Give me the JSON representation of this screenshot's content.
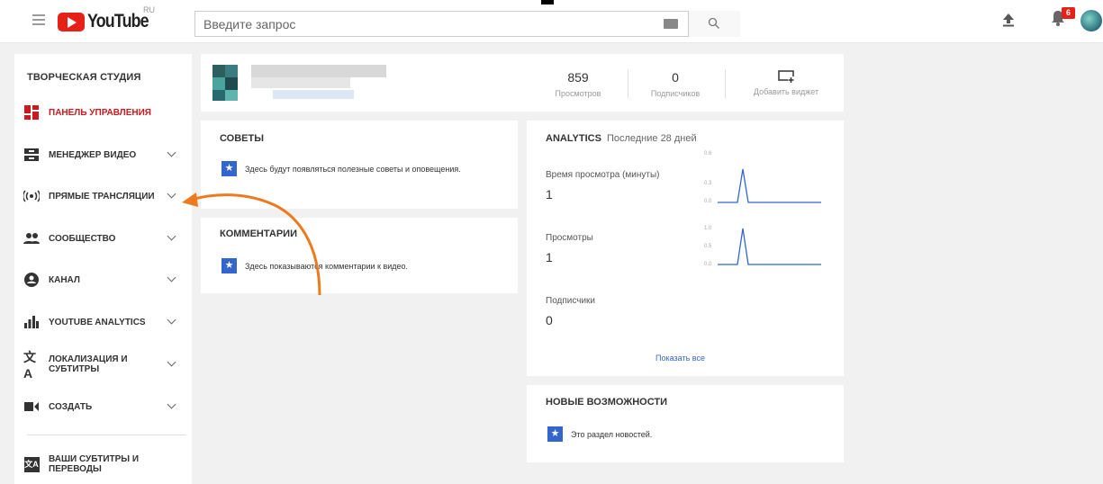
{
  "header": {
    "logo_text": "YouTube",
    "logo_region": "RU",
    "search_placeholder": "Введите запрос",
    "icons": [
      "menu-icon",
      "keyboard-icon",
      "search-icon",
      "upload-icon",
      "bell-icon"
    ],
    "notifications_count": "6",
    "accent_color": "#e62117"
  },
  "sidebar": {
    "title": "ТВОРЧЕСКАЯ СТУДИЯ",
    "items": [
      {
        "label": "ПАНЕЛЬ УПРАВЛЕНИЯ",
        "icon": "dashboard-icon",
        "active": true
      },
      {
        "label": "МЕНЕДЖЕР ВИДЕО",
        "icon": "video-manager-icon"
      },
      {
        "label": "ПРЯМЫЕ ТРАНСЛЯЦИИ",
        "icon": "live-icon"
      },
      {
        "label": "СООБЩЕСТВО",
        "icon": "community-icon"
      },
      {
        "label": "КАНАЛ",
        "icon": "channel-icon"
      },
      {
        "label": "YOUTUBE ANALYTICS",
        "icon": "analytics-icon"
      },
      {
        "label": "ЛОКАЛИЗАЦИЯ И СУБТИТРЫ",
        "icon": "translate-icon"
      },
      {
        "label": "СОЗДАТЬ",
        "icon": "create-icon"
      },
      {
        "label": "ВАШИ СУБТИТРЫ И ПЕРЕВОДЫ",
        "icon": "subtitles-icon"
      }
    ],
    "active_color": "#cc181e"
  },
  "channel": {
    "views_num": "859",
    "views_cap": "Просмотров",
    "subs_num": "0",
    "subs_cap": "Подписчиков",
    "widget_cap": "Добавить виджет"
  },
  "tips": {
    "title": "СОВЕТЫ",
    "message": "Здесь будут появляться полезные советы и оповещения."
  },
  "comments": {
    "title": "КОММЕНТАРИИ",
    "message": "Здесь показываются комментарии к видео."
  },
  "analytics": {
    "title": "ANALYTICS",
    "period": "Последние 28 дней",
    "watch_label": "Время просмотра (минуты)",
    "watch_value": "1",
    "watch_ticks": [
      "0.6",
      "0.3",
      "0.0"
    ],
    "views_label": "Просмотры",
    "views_value": "1",
    "views_ticks": [
      "1.0",
      "0.5",
      "0.0"
    ],
    "subs_label": "Подписчики",
    "subs_value": "0",
    "show_all": "Показать все"
  },
  "news": {
    "title": "НОВЫЕ ВОЗМОЖНОСТИ",
    "message": "Это раздел новостей."
  },
  "annotation_color": "#ee7a1e"
}
